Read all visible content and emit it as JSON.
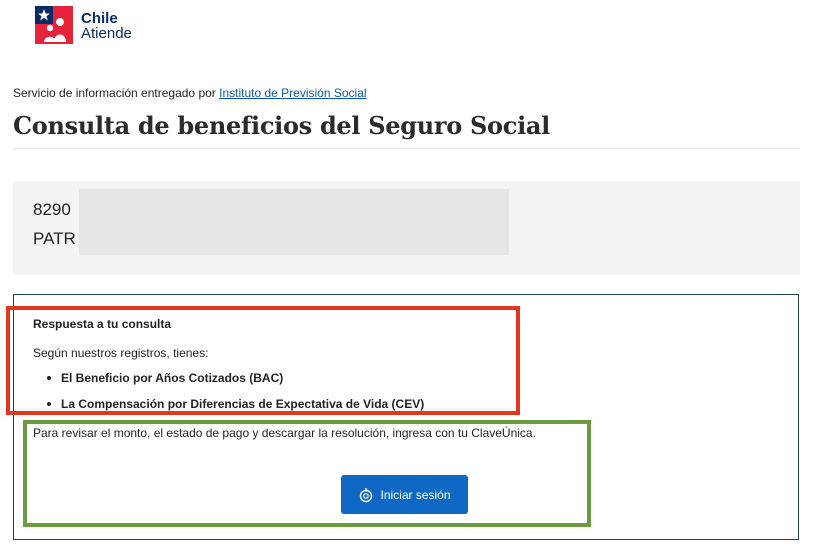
{
  "brand": {
    "line1": "Chile",
    "line2": "Atiende"
  },
  "info": {
    "prefix": "Servicio de información entregado por",
    "link": "Instituto de Previsión Social"
  },
  "page": {
    "title": "Consulta de beneficios del Seguro Social"
  },
  "user": {
    "id_partial": "8290",
    "name_partial": "PATR"
  },
  "result": {
    "heading": "Respuesta a tu consulta",
    "intro": "Según nuestros registros, tienes:",
    "benefits": [
      "El Beneficio por Años Cotizados (BAC)",
      "La Compensación por Diferencias de Expectativa de Vida (CEV)"
    ],
    "review_text": "Para revisar el monto, el estado de pago y descargar la resolución, ingresa con tu ClaveÚnica.",
    "login_button": "Iniciar sesión"
  },
  "colors": {
    "primary_button": "#0f69c4",
    "link": "#0b5aa6",
    "highlight_red": "#e2361e",
    "highlight_green": "#6c9a3e",
    "logo_blue": "#0a2a66",
    "logo_red": "#e5233b"
  },
  "icons": {
    "logo": "chile-atiende-logo",
    "login": "clave-unica-icon"
  }
}
